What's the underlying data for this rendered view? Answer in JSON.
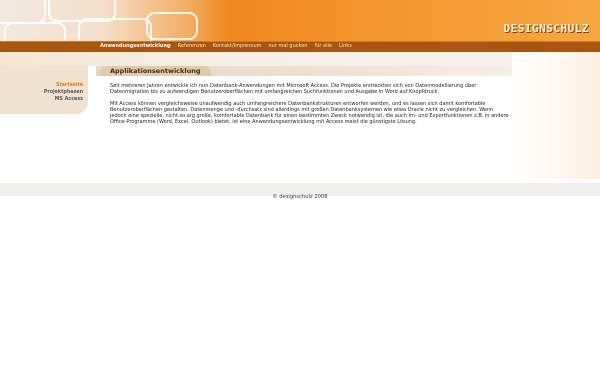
{
  "header": {
    "logo_text": "DESIGNSCHULZ"
  },
  "nav": {
    "items": [
      {
        "label": "Anwendungsentwicklung",
        "active": true
      },
      {
        "label": "Referenzen",
        "active": false
      },
      {
        "label": "Kontakt/Impressum",
        "active": false
      },
      {
        "label": "nur mal gucken",
        "active": false
      },
      {
        "label": "für alle",
        "active": false
      },
      {
        "label": "Links",
        "active": false
      }
    ]
  },
  "sidebar": {
    "items": [
      {
        "label": "Startseite",
        "active": true
      },
      {
        "label": "Projektphasen",
        "active": false
      },
      {
        "label": "MS Access",
        "active": false
      }
    ]
  },
  "main": {
    "title": "Applikationsentwicklung",
    "paragraphs": [
      "Seit mehreren Jahren entwickle ich nun Datenbank-Anwendungen mit Microsoft Access. Die Projekte erstreckten sich von Datenmodellierung über Datenmigration bis zu aufwendigen Benutzeroberflächen mit umfangreichen Suchfunktionen und Ausgabe in Word auf Knopfdruck.",
      "Mit Access können vergleichsweise unaufwendig auch umfangreichere Datenbankstrukturen entworfen werden, und es lassen sich damit komfortable Benutzeroberflächen gestalten. Datenmenge und -durchsatz sind allerdings mit großen Datenbanksystemen wie etwa Oracle nicht zu vergleichen. Wenn jedoch eine spezielle, nicht so arg große, komfortable Datenbank für einen bestimmten Zweck notwendig ist, die auch Im- und Exportfunktionen z.B. in andere Office-Programme (Word, Excel, Outlook) bietet, ist eine Anwendungsentwicklung mit Access meist die günstigste Lösung."
    ]
  },
  "footer": {
    "text": "© designschulz 2008"
  },
  "colors": {
    "brand_orange": "#f07f10",
    "nav_bar": "#a85510",
    "active_link": "#e27a10"
  }
}
